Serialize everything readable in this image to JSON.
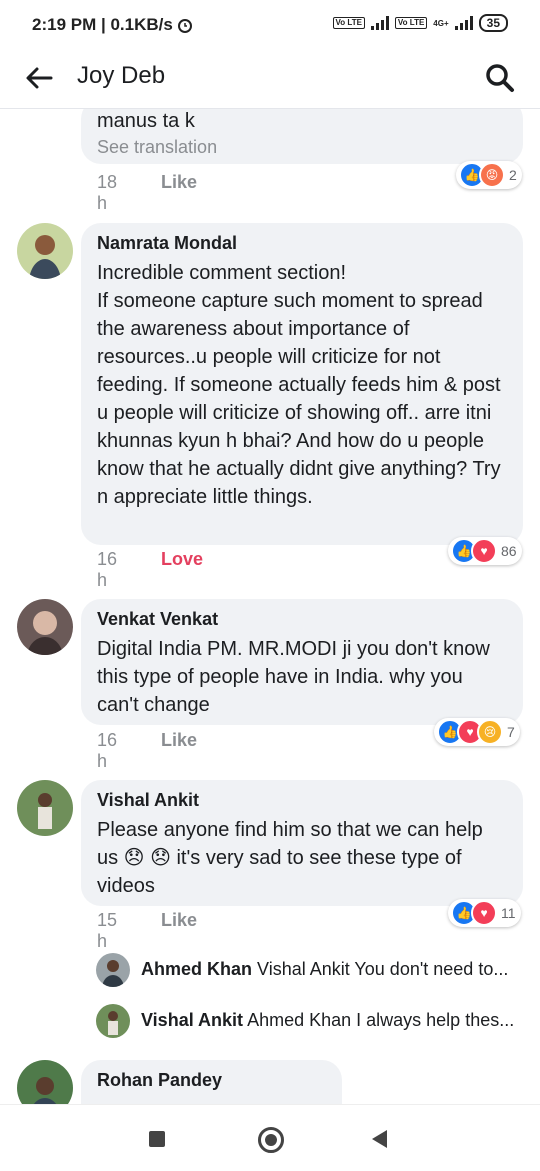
{
  "status_bar": {
    "time_speed": "2:19 PM | 0.1KB/s",
    "lte1": "Vo LTE",
    "lte2": "Vo LTE",
    "net": "4G+",
    "battery": "35"
  },
  "header": {
    "title": "Joy Deb",
    "back_icon": "back-arrow-icon",
    "search_icon": "search-icon"
  },
  "comments": [
    {
      "body": "manus ta k",
      "translation": "See translation",
      "time": "18 h",
      "action": "Like",
      "reactions": [
        "like",
        "angry"
      ],
      "count": "2"
    },
    {
      "author": "Namrata Mondal",
      "body": "Incredible comment section!\nIf someone capture such moment to spread the awareness about importance of resources..u people will criticize for not feeding. If someone actually feeds him & post u people will criticize of showing off.. arre itni khunnas kyun h bhai? And how do u people know that he actually didnt give anything? Try n appreciate little things.",
      "time": "16 h",
      "action": "Love",
      "reactions": [
        "like",
        "love"
      ],
      "count": "86"
    },
    {
      "author": "Venkat Venkat",
      "body": "Digital India PM. MR.MODI ji you don't know this type of people have in India. why you can't change",
      "time": "16 h",
      "action": "Like",
      "reactions": [
        "like",
        "love",
        "sad"
      ],
      "count": "7"
    },
    {
      "author": "Vishal Ankit",
      "body": "Please anyone find him so that we can help us 😞 😞 it's very sad to see these type of videos",
      "time": "15 h",
      "action": "Like",
      "reactions": [
        "like",
        "love"
      ],
      "count": "11"
    },
    {
      "author": "Rohan Pandey"
    }
  ],
  "replies": [
    {
      "name": "Ahmed Khan",
      "text": "Vishal Ankit  You don't need to..."
    },
    {
      "name": "Vishal Ankit",
      "text": "Ahmed Khan I always help thes..."
    }
  ],
  "colors": {
    "bubble": "#f0f2f5",
    "like_blue": "#1877f2",
    "love_red": "#f33e58",
    "love_text": "#e4405f",
    "meta_gray": "#8a8d91"
  }
}
